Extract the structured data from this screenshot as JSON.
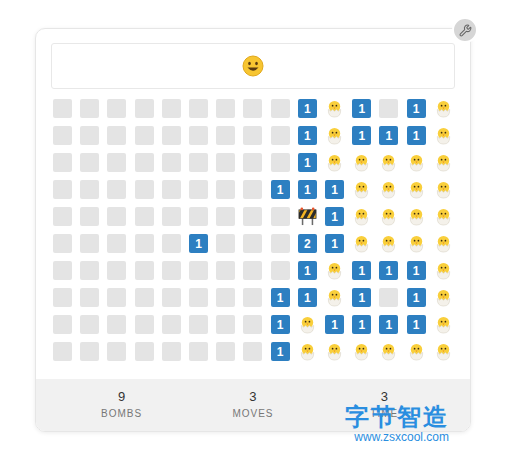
{
  "board": {
    "rows": [
      [
        {
          "kind": "hidden"
        },
        {
          "kind": "hidden"
        },
        {
          "kind": "hidden"
        },
        {
          "kind": "hidden"
        },
        {
          "kind": "hidden"
        },
        {
          "kind": "hidden"
        },
        {
          "kind": "hidden"
        },
        {
          "kind": "hidden"
        },
        {
          "kind": "hidden"
        },
        {
          "kind": "number",
          "text": "1"
        },
        {
          "kind": "open"
        },
        {
          "kind": "number",
          "text": "1"
        },
        {
          "kind": "hidden"
        },
        {
          "kind": "number",
          "text": "1"
        },
        {
          "kind": "open"
        }
      ],
      [
        {
          "kind": "hidden"
        },
        {
          "kind": "hidden"
        },
        {
          "kind": "hidden"
        },
        {
          "kind": "hidden"
        },
        {
          "kind": "hidden"
        },
        {
          "kind": "hidden"
        },
        {
          "kind": "hidden"
        },
        {
          "kind": "hidden"
        },
        {
          "kind": "hidden"
        },
        {
          "kind": "number",
          "text": "1"
        },
        {
          "kind": "open"
        },
        {
          "kind": "number",
          "text": "1"
        },
        {
          "kind": "number",
          "text": "1"
        },
        {
          "kind": "number",
          "text": "1"
        },
        {
          "kind": "open"
        }
      ],
      [
        {
          "kind": "hidden"
        },
        {
          "kind": "hidden"
        },
        {
          "kind": "hidden"
        },
        {
          "kind": "hidden"
        },
        {
          "kind": "hidden"
        },
        {
          "kind": "hidden"
        },
        {
          "kind": "hidden"
        },
        {
          "kind": "hidden"
        },
        {
          "kind": "hidden"
        },
        {
          "kind": "number",
          "text": "1"
        },
        {
          "kind": "open"
        },
        {
          "kind": "open"
        },
        {
          "kind": "open"
        },
        {
          "kind": "open"
        },
        {
          "kind": "open"
        }
      ],
      [
        {
          "kind": "hidden"
        },
        {
          "kind": "hidden"
        },
        {
          "kind": "hidden"
        },
        {
          "kind": "hidden"
        },
        {
          "kind": "hidden"
        },
        {
          "kind": "hidden"
        },
        {
          "kind": "hidden"
        },
        {
          "kind": "hidden"
        },
        {
          "kind": "number",
          "text": "1"
        },
        {
          "kind": "number",
          "text": "1"
        },
        {
          "kind": "number",
          "text": "1"
        },
        {
          "kind": "open"
        },
        {
          "kind": "open"
        },
        {
          "kind": "open"
        },
        {
          "kind": "open"
        }
      ],
      [
        {
          "kind": "hidden"
        },
        {
          "kind": "hidden"
        },
        {
          "kind": "hidden"
        },
        {
          "kind": "hidden"
        },
        {
          "kind": "hidden"
        },
        {
          "kind": "hidden"
        },
        {
          "kind": "hidden"
        },
        {
          "kind": "hidden"
        },
        {
          "kind": "hidden"
        },
        {
          "kind": "flag"
        },
        {
          "kind": "number",
          "text": "1"
        },
        {
          "kind": "open"
        },
        {
          "kind": "open"
        },
        {
          "kind": "open"
        },
        {
          "kind": "open"
        }
      ],
      [
        {
          "kind": "hidden"
        },
        {
          "kind": "hidden"
        },
        {
          "kind": "hidden"
        },
        {
          "kind": "hidden"
        },
        {
          "kind": "hidden"
        },
        {
          "kind": "number",
          "text": "1"
        },
        {
          "kind": "hidden"
        },
        {
          "kind": "hidden"
        },
        {
          "kind": "hidden"
        },
        {
          "kind": "number",
          "text": "2"
        },
        {
          "kind": "number",
          "text": "1"
        },
        {
          "kind": "open"
        },
        {
          "kind": "open"
        },
        {
          "kind": "open"
        },
        {
          "kind": "open"
        }
      ],
      [
        {
          "kind": "hidden"
        },
        {
          "kind": "hidden"
        },
        {
          "kind": "hidden"
        },
        {
          "kind": "hidden"
        },
        {
          "kind": "hidden"
        },
        {
          "kind": "hidden"
        },
        {
          "kind": "hidden"
        },
        {
          "kind": "hidden"
        },
        {
          "kind": "hidden"
        },
        {
          "kind": "number",
          "text": "1"
        },
        {
          "kind": "open"
        },
        {
          "kind": "number",
          "text": "1"
        },
        {
          "kind": "number",
          "text": "1"
        },
        {
          "kind": "number",
          "text": "1"
        },
        {
          "kind": "open"
        }
      ],
      [
        {
          "kind": "hidden"
        },
        {
          "kind": "hidden"
        },
        {
          "kind": "hidden"
        },
        {
          "kind": "hidden"
        },
        {
          "kind": "hidden"
        },
        {
          "kind": "hidden"
        },
        {
          "kind": "hidden"
        },
        {
          "kind": "hidden"
        },
        {
          "kind": "number",
          "text": "1"
        },
        {
          "kind": "number",
          "text": "1"
        },
        {
          "kind": "open"
        },
        {
          "kind": "number",
          "text": "1"
        },
        {
          "kind": "hidden"
        },
        {
          "kind": "number",
          "text": "1"
        },
        {
          "kind": "open"
        }
      ],
      [
        {
          "kind": "hidden"
        },
        {
          "kind": "hidden"
        },
        {
          "kind": "hidden"
        },
        {
          "kind": "hidden"
        },
        {
          "kind": "hidden"
        },
        {
          "kind": "hidden"
        },
        {
          "kind": "hidden"
        },
        {
          "kind": "hidden"
        },
        {
          "kind": "number",
          "text": "1"
        },
        {
          "kind": "open"
        },
        {
          "kind": "number",
          "text": "1"
        },
        {
          "kind": "number",
          "text": "1"
        },
        {
          "kind": "number",
          "text": "1"
        },
        {
          "kind": "number",
          "text": "1"
        },
        {
          "kind": "open"
        }
      ],
      [
        {
          "kind": "hidden"
        },
        {
          "kind": "hidden"
        },
        {
          "kind": "hidden"
        },
        {
          "kind": "hidden"
        },
        {
          "kind": "hidden"
        },
        {
          "kind": "hidden"
        },
        {
          "kind": "hidden"
        },
        {
          "kind": "hidden"
        },
        {
          "kind": "number",
          "text": "1"
        },
        {
          "kind": "open"
        },
        {
          "kind": "open"
        },
        {
          "kind": "open"
        },
        {
          "kind": "open"
        },
        {
          "kind": "open"
        },
        {
          "kind": "open"
        }
      ]
    ]
  },
  "stats": [
    {
      "value": "9",
      "label": "BOMBS"
    },
    {
      "value": "3",
      "label": "MOVES"
    },
    {
      "value": "3",
      "label": "TIME"
    }
  ],
  "watermark": {
    "title": "字节智造",
    "url": "www.zsxcool.com"
  }
}
